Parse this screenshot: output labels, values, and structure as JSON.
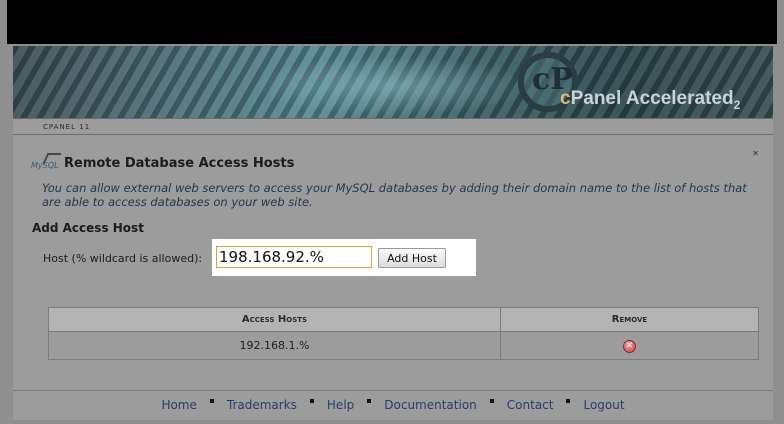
{
  "banner": {
    "logo_prefix": "c",
    "logo_text": "Panel Accelerated",
    "logo_subscript": "2"
  },
  "breadcrumb": "CPANEL 11",
  "page": {
    "title": "Remote Database Access Hosts",
    "description": "You can allow external web servers to access your MySQL databases by adding their domain name to the list of hosts that are able to access databases on your web site.",
    "icon_text": "MySQL"
  },
  "add_section": {
    "title": "Add Access Host",
    "host_label": "Host (% wildcard is allowed):",
    "host_value": "198.168.92.%",
    "button_label": "Add Host"
  },
  "table": {
    "headers": [
      "Access Hosts",
      "Remove"
    ],
    "rows": [
      {
        "host": "192.168.1.%",
        "remove_icon": "remove-x-icon"
      }
    ]
  },
  "footer": {
    "links": [
      "Home",
      "Trademarks",
      "Help",
      "Documentation",
      "Contact",
      "Logout"
    ]
  },
  "colors": {
    "background_dim": "#8e8e8e",
    "highlight": "#ffffff",
    "input_border": "#d4a43a",
    "link": "#2d3d6a",
    "remove_icon": "#c84040"
  }
}
